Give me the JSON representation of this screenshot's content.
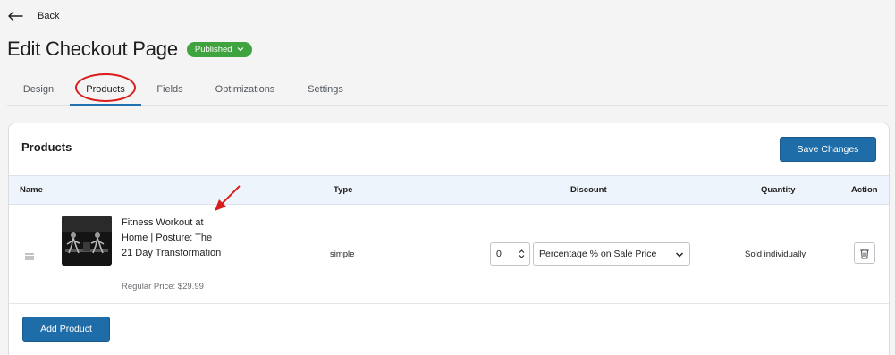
{
  "header": {
    "back_label": "Back",
    "page_title": "Edit Checkout Page",
    "status_label": "Published"
  },
  "tabs": [
    {
      "label": "Design"
    },
    {
      "label": "Products",
      "active": true
    },
    {
      "label": "Fields"
    },
    {
      "label": "Optimizations"
    },
    {
      "label": "Settings"
    }
  ],
  "products_panel": {
    "title": "Products",
    "save_label": "Save Changes",
    "columns": [
      "Name",
      "Type",
      "Discount",
      "Quantity",
      "Action"
    ],
    "rows": [
      {
        "name": "Fitness Workout at Home | Posture: The 21 Day Transformation",
        "price": "Regular Price: $29.99",
        "type": "simple",
        "discount_value": "0",
        "discount_type": "Percentage % on Sale Price",
        "quantity": "Sold individually"
      }
    ],
    "add_label": "Add Product"
  },
  "colors": {
    "accent": "#1f6da8",
    "published": "#3fa33f",
    "annotation": "#d91c1c",
    "table_header_bg": "#eef4fb"
  }
}
